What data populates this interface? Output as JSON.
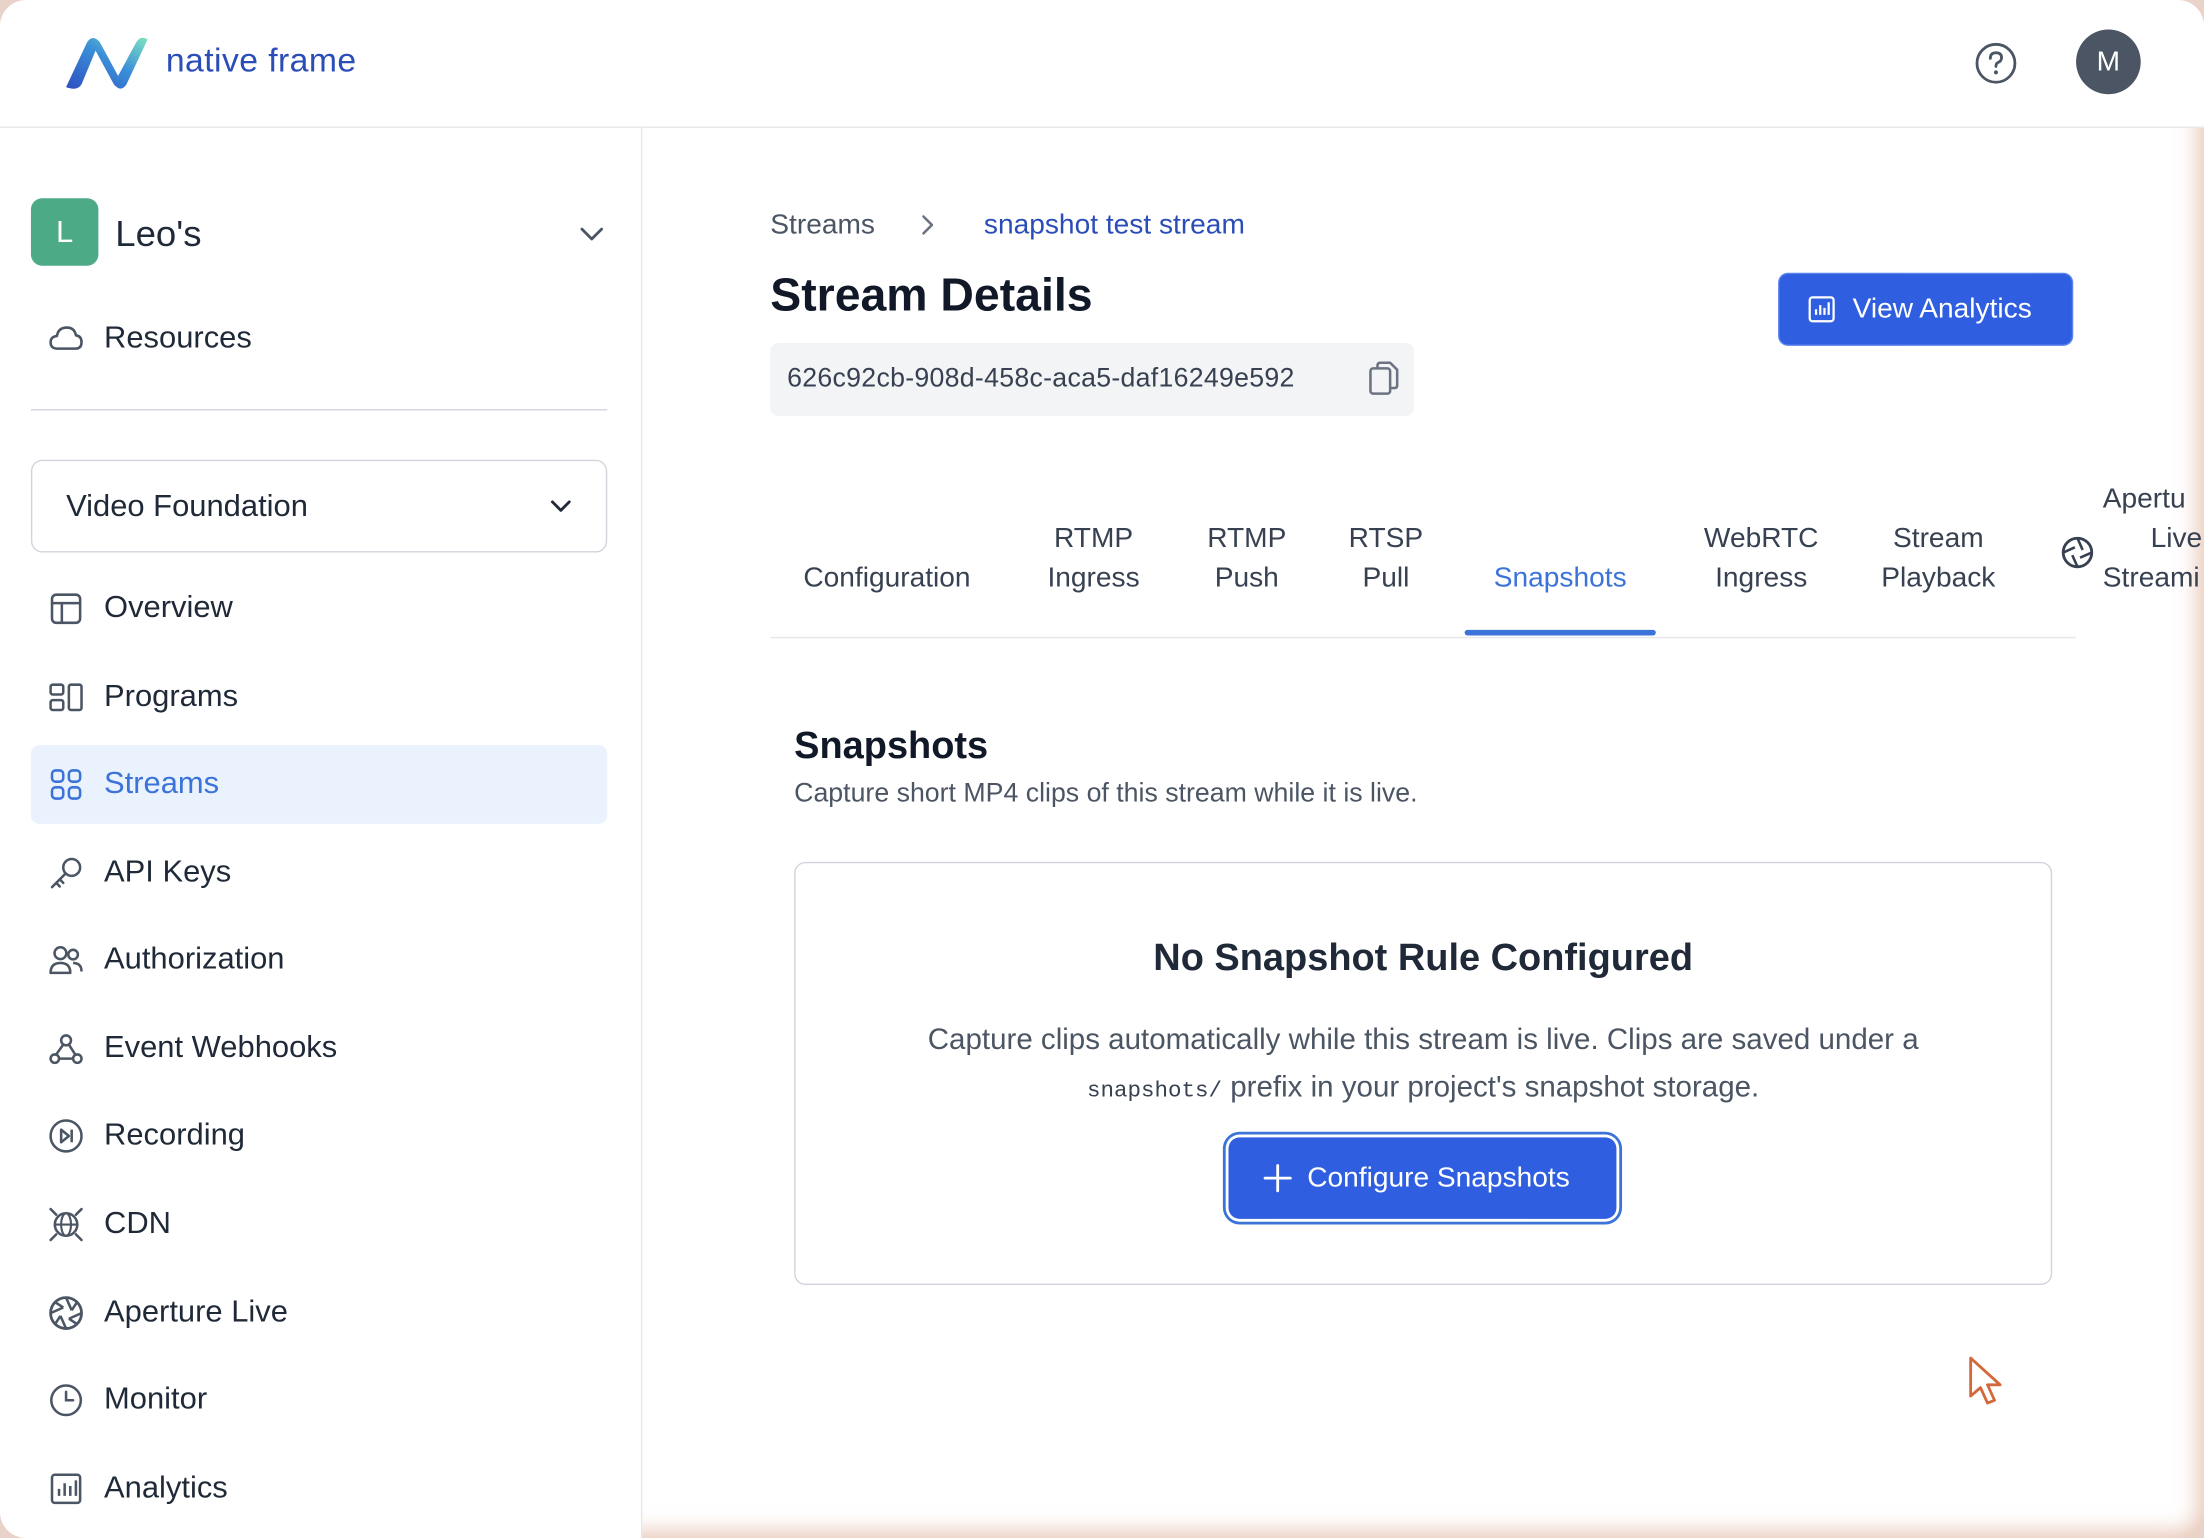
{
  "header": {
    "logo_text": "native frame",
    "avatar_initial": "M"
  },
  "sidebar": {
    "org_badge": "L",
    "org_name": "Leo's",
    "resources_label": "Resources",
    "project_select": "Video Foundation",
    "items": [
      {
        "label": "Overview",
        "icon": "layout-icon"
      },
      {
        "label": "Programs",
        "icon": "programs-icon"
      },
      {
        "label": "Streams",
        "icon": "grid-icon",
        "active": true
      },
      {
        "label": "API Keys",
        "icon": "key-icon"
      },
      {
        "label": "Authorization",
        "icon": "users-icon"
      },
      {
        "label": "Event Webhooks",
        "icon": "webhook-icon"
      },
      {
        "label": "Recording",
        "icon": "record-icon"
      },
      {
        "label": "CDN",
        "icon": "globe-icon"
      },
      {
        "label": "Aperture Live",
        "icon": "aperture-icon"
      },
      {
        "label": "Monitor",
        "icon": "clock-icon"
      },
      {
        "label": "Analytics",
        "icon": "bar-chart-icon"
      }
    ]
  },
  "main": {
    "breadcrumb": {
      "parent": "Streams",
      "current": "snapshot test stream"
    },
    "title": "Stream Details",
    "stream_id": "626c92cb-908d-458c-aca5-daf16249e592",
    "view_analytics_label": "View Analytics",
    "tabs": [
      {
        "line1": "",
        "line2": "Configuration"
      },
      {
        "line1": "RTMP",
        "line2": "Ingress"
      },
      {
        "line1": "RTMP",
        "line2": "Push"
      },
      {
        "line1": "RTSP",
        "line2": "Pull"
      },
      {
        "line1": "",
        "line2": "Snapshots",
        "active": true
      },
      {
        "line1": "WebRTC",
        "line2": "Ingress"
      },
      {
        "line1": "Stream",
        "line2": "Playback"
      },
      {
        "line0": "Apertu",
        "line1": "Live",
        "line2": "Streami"
      }
    ],
    "section": {
      "title": "Snapshots",
      "subtitle": "Capture short MP4 clips of this stream while it is live."
    },
    "empty_card": {
      "title": "No Snapshot Rule Configured",
      "desc_line1": "Capture clips automatically while this stream is live. Clips are saved under a",
      "desc_code": "snapshots/",
      "desc_line2_rest": " prefix in your project's snapshot storage.",
      "button_label": "Configure Snapshots"
    }
  },
  "colors": {
    "accent": "#3b73d9",
    "button": "#2f5fe0",
    "org_badge": "#4daa86",
    "active_nav_bg": "#eaf2fd"
  }
}
